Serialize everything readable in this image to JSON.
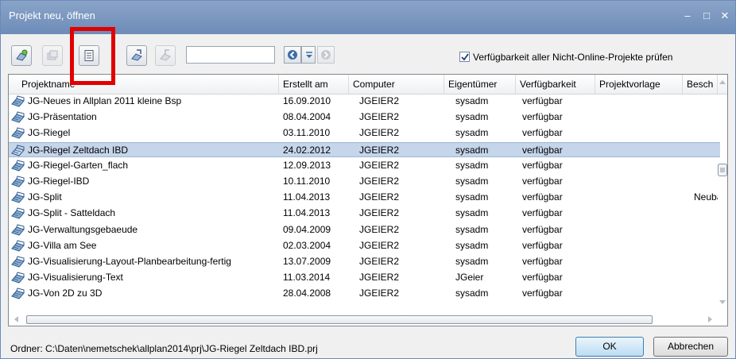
{
  "window": {
    "title": "Projekt neu, öffnen",
    "controls": {
      "minimize": "–",
      "maximize": "□",
      "close": "✕"
    }
  },
  "toolbar": {
    "icons": [
      "new-project-icon",
      "copy-project-icon",
      "properties-icon",
      "import-icon",
      "export-icon"
    ],
    "search_value": "",
    "nav_icons": [
      "search-previous-icon",
      "dropdown-icon",
      "search-next-icon"
    ],
    "availability_check_label": "Verfügbarkeit aller Nicht-Online-Projekte prüfen",
    "availability_check_checked": true
  },
  "table": {
    "columns": [
      "Projektname",
      "Erstellt am",
      "Computer",
      "Eigentümer",
      "Verfügbarkeit",
      "Projektvorlage",
      "Besch"
    ],
    "rows": [
      {
        "name": "JG-Neues in Allplan 2011 kleine Bsp",
        "created": "16.09.2010",
        "computer": "JGEIER2",
        "owner": "sysadm",
        "availability": "verfügbar",
        "template": "",
        "desc": ""
      },
      {
        "name": "JG-Präsentation",
        "created": "08.04.2004",
        "computer": "JGEIER2",
        "owner": "sysadm",
        "availability": "verfügbar",
        "template": "",
        "desc": ""
      },
      {
        "name": "JG-Riegel",
        "created": "03.11.2010",
        "computer": "JGEIER2",
        "owner": "sysadm",
        "availability": "verfügbar",
        "template": "",
        "desc": ""
      },
      {
        "name": "JG-Riegel Zeltdach IBD",
        "created": "24.02.2012",
        "computer": "JGEIER2",
        "owner": "sysadm",
        "availability": "verfügbar",
        "template": "",
        "desc": "",
        "selected": true
      },
      {
        "name": "JG-Riegel-Garten_flach",
        "created": "12.09.2013",
        "computer": "JGEIER2",
        "owner": "sysadm",
        "availability": "verfügbar",
        "template": "",
        "desc": ""
      },
      {
        "name": "JG-Riegel-IBD",
        "created": "10.11.2010",
        "computer": "JGEIER2",
        "owner": "sysadm",
        "availability": "verfügbar",
        "template": "",
        "desc": ""
      },
      {
        "name": "JG-Split",
        "created": "11.04.2013",
        "computer": "JGEIER2",
        "owner": "sysadm",
        "availability": "verfügbar",
        "template": "",
        "desc": "Neuba"
      },
      {
        "name": "JG-Split - Satteldach",
        "created": "11.04.2013",
        "computer": "JGEIER2",
        "owner": "sysadm",
        "availability": "verfügbar",
        "template": "",
        "desc": ""
      },
      {
        "name": "JG-Verwaltungsgebaeude",
        "created": "09.04.2009",
        "computer": "JGEIER2",
        "owner": "sysadm",
        "availability": "verfügbar",
        "template": "",
        "desc": ""
      },
      {
        "name": "JG-Villa am See",
        "created": "02.03.2004",
        "computer": "JGEIER2",
        "owner": "sysadm",
        "availability": "verfügbar",
        "template": "",
        "desc": ""
      },
      {
        "name": "JG-Visualisierung-Layout-Planbearbeitung-fertig",
        "created": "13.07.2009",
        "computer": "JGEIER2",
        "owner": "sysadm",
        "availability": "verfügbar",
        "template": "",
        "desc": ""
      },
      {
        "name": "JG-Visualisierung-Text",
        "created": "11.03.2014",
        "computer": "JGEIER2",
        "owner": "JGeier",
        "availability": "verfügbar",
        "template": "",
        "desc": ""
      },
      {
        "name": "JG-Von 2D zu 3D",
        "created": "28.04.2008",
        "computer": "JGEIER2",
        "owner": "sysadm",
        "availability": "verfügbar",
        "template": "",
        "desc": ""
      }
    ]
  },
  "footer": {
    "folder_label": "Ordner: C:\\Daten\\nemetschek\\allplan2014\\prj\\JG-Riegel Zeltdach IBD.prj",
    "ok_label": "OK",
    "cancel_label": "Abbrechen"
  },
  "colors": {
    "title_bar": "#7996bf",
    "selected_row": "#c5d5ea",
    "highlight_box": "#e10000"
  }
}
